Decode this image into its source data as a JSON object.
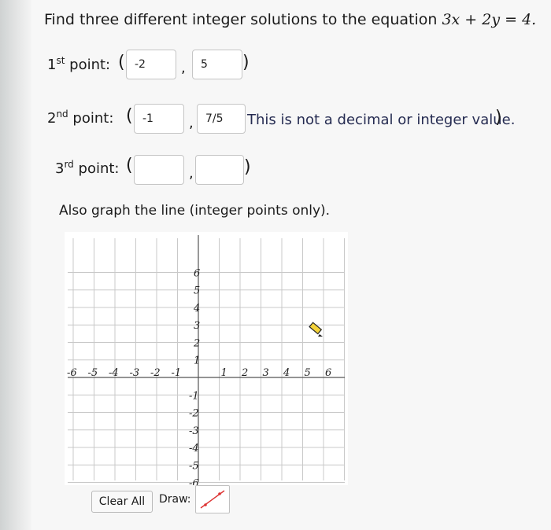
{
  "question": {
    "text": "Find three different integer solutions to the equation ",
    "equation": "3x + 2y = 4."
  },
  "points": [
    {
      "num": "1",
      "suffix": "st",
      "label": " point:",
      "x": "-2",
      "y": "5"
    },
    {
      "num": "2",
      "suffix": "nd",
      "label": " point:",
      "x": "-1",
      "y": "7/5"
    },
    {
      "num": "3",
      "suffix": "rd",
      "label": " point:",
      "x": "",
      "y": ""
    }
  ],
  "warning": "This is not a decimal or integer value.",
  "instruction": "Also graph the line (integer points only).",
  "graph": {
    "x_ticks": [
      "-6",
      "-5",
      "-4",
      "-3",
      "-2",
      "-1",
      "1",
      "2",
      "3",
      "4",
      "5",
      "6"
    ],
    "y_ticks": [
      "6",
      "5",
      "4",
      "3",
      "2",
      "1",
      "-1",
      "-2",
      "-3",
      "-4",
      "-5",
      "-6"
    ]
  },
  "controls": {
    "clear_all": "Clear All",
    "draw_label": "Draw:"
  },
  "colors": {
    "grid": "#c9c9c9",
    "axis": "#555555",
    "warning": "#262c52",
    "draw_tool": "#d33"
  }
}
